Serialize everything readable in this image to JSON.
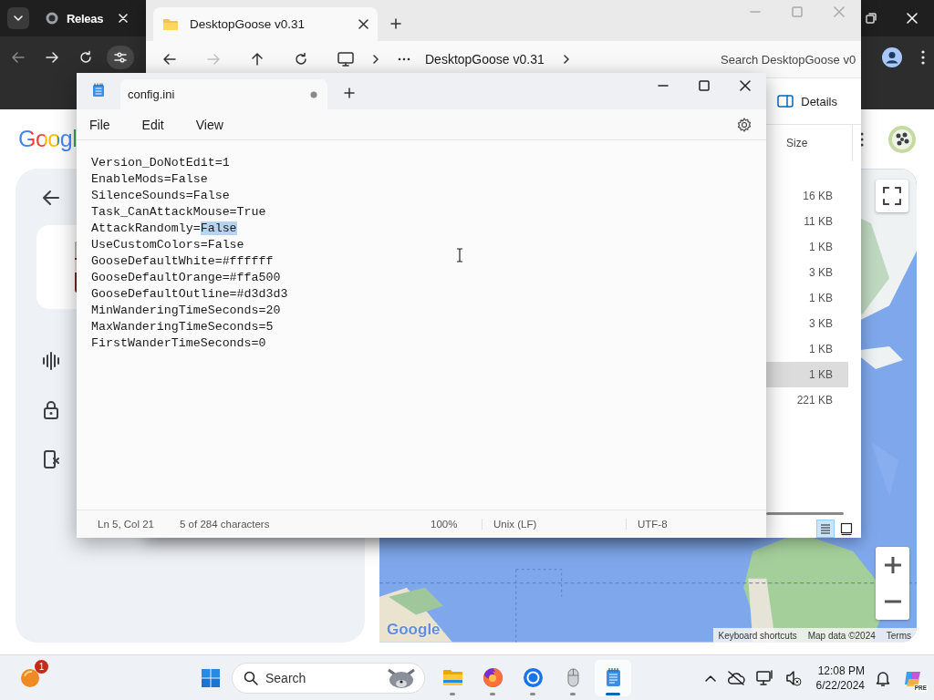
{
  "browser": {
    "tab": {
      "title": "Releas"
    },
    "page": {
      "logo": "Googl",
      "side_items": [
        {
          "kind": "audio"
        },
        {
          "kind": "lock"
        },
        {
          "kind": "phone"
        }
      ],
      "map": {
        "kind": "picture",
        "logo": "Google",
        "footer": [
          "Keyboard shortcuts",
          "Map data ©2024",
          "Terms"
        ]
      }
    }
  },
  "explorer": {
    "title": "DesktopGoose v0.31",
    "nav": [
      {
        "kind": "back",
        "disabled": false
      },
      {
        "kind": "forward",
        "disabled": true
      },
      {
        "kind": "up",
        "disabled": false
      },
      {
        "kind": "refresh",
        "disabled": false
      }
    ],
    "breadcrumb": "DesktopGoose v0.31",
    "search": {
      "placeholder": "Search DesktopGoose v0"
    },
    "details_button": "Details",
    "columns": [
      "Size"
    ],
    "rows": [
      {
        "size": "16 KB",
        "selected": false
      },
      {
        "size": "11 KB",
        "selected": false
      },
      {
        "size": "1 KB",
        "selected": false
      },
      {
        "size": "3 KB",
        "selected": false
      },
      {
        "size": "1 KB",
        "selected": false
      },
      {
        "size": "3 KB",
        "selected": false
      },
      {
        "size": "1 KB",
        "selected": false
      },
      {
        "size": "1 KB",
        "selected": true
      },
      {
        "size": "221 KB",
        "selected": false
      }
    ],
    "views": [
      {
        "kind": "details",
        "selected": true
      },
      {
        "kind": "tiles",
        "selected": false
      }
    ]
  },
  "notepad": {
    "tab": {
      "title": "config.ini",
      "modified": true
    },
    "menu": [
      "File",
      "Edit",
      "View"
    ],
    "lines": [
      {
        "segments": [
          {
            "text": "Version_DoNotEdit=1",
            "selected": false
          }
        ]
      },
      {
        "segments": [
          {
            "text": "EnableMods=False",
            "selected": false
          }
        ]
      },
      {
        "segments": [
          {
            "text": "SilenceSounds=False",
            "selected": false
          }
        ]
      },
      {
        "segments": [
          {
            "text": "Task_CanAttackMouse=True",
            "selected": false
          }
        ]
      },
      {
        "segments": [
          {
            "text": "AttackRandomly=",
            "selected": false
          },
          {
            "text": "False",
            "selected": true
          }
        ]
      },
      {
        "segments": [
          {
            "text": "UseCustomColors=False",
            "selected": false
          }
        ]
      },
      {
        "segments": [
          {
            "text": "GooseDefaultWhite=#ffffff",
            "selected": false
          }
        ]
      },
      {
        "segments": [
          {
            "text": "GooseDefaultOrange=#ffa500",
            "selected": false
          }
        ]
      },
      {
        "segments": [
          {
            "text": "GooseDefaultOutline=#d3d3d3",
            "selected": false
          }
        ]
      },
      {
        "segments": [
          {
            "text": "MinWanderingTimeSeconds=20",
            "selected": false
          }
        ]
      },
      {
        "segments": [
          {
            "text": "MaxWanderingTimeSeconds=5",
            "selected": false
          }
        ]
      },
      {
        "segments": [
          {
            "text": "FirstWanderTimeSeconds=0",
            "selected": false
          }
        ]
      }
    ],
    "status": [
      "Ln 5, Col 21",
      "5 of 284 characters",
      "100%",
      "Unix (LF)",
      "UTF-8"
    ]
  },
  "taskbar": {
    "notification_badge": "1",
    "search": {
      "placeholder": "Search"
    },
    "apps": [
      {
        "kind": "explorer",
        "running": true,
        "selected": false
      },
      {
        "kind": "firefox",
        "running": true,
        "selected": false
      },
      {
        "kind": "chrome",
        "running": true,
        "selected": false
      },
      {
        "kind": "mouse",
        "running": true,
        "selected": false
      },
      {
        "kind": "notepad",
        "running": true,
        "selected": true
      }
    ],
    "time": "12:08 PM",
    "date": "6/22/2024",
    "copilot_badge": "PRE"
  }
}
